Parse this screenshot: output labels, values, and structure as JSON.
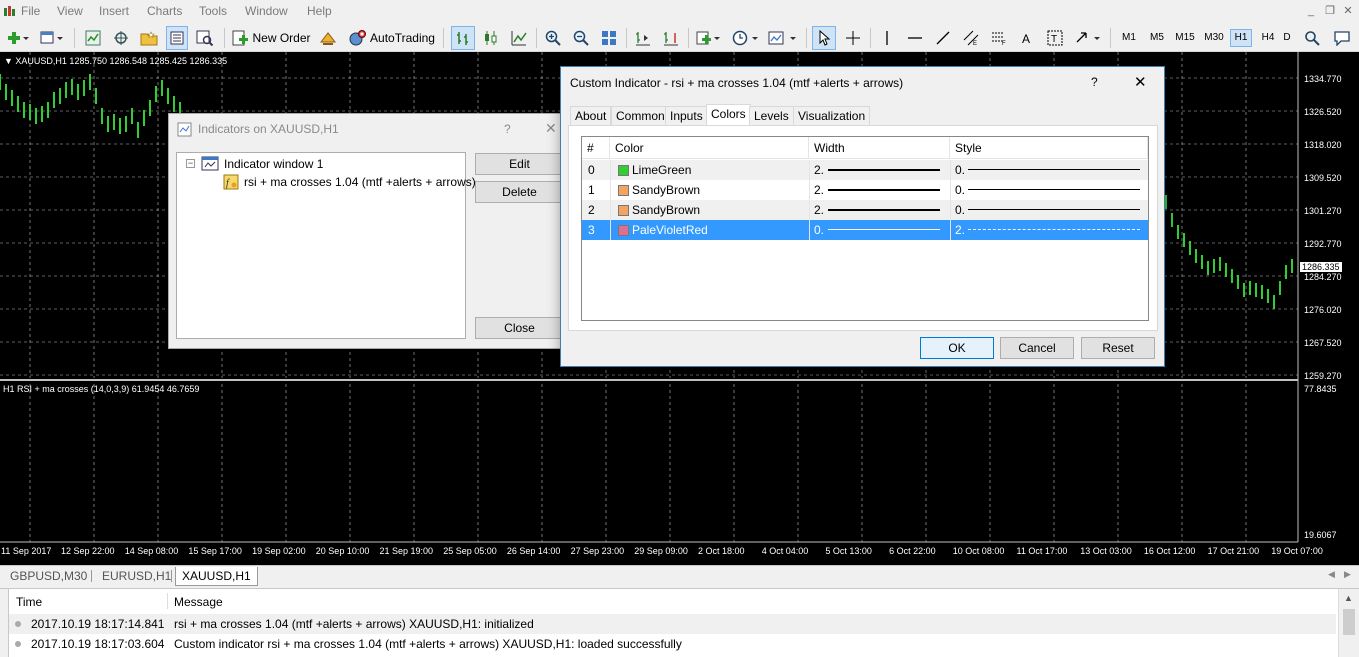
{
  "menu": [
    "File",
    "View",
    "Insert",
    "Charts",
    "Tools",
    "Window",
    "Help"
  ],
  "toolbar": {
    "new_order": "New Order",
    "auto_trading": "AutoTrading",
    "timeframes": [
      "M1",
      "M5",
      "M15",
      "M30",
      "H1",
      "H4",
      "D"
    ],
    "active_timeframe": "H1"
  },
  "chart": {
    "symbol_info": "XAUUSD,H1  1285.750 1286.548 1285.425 1286.335",
    "indicator_info": "H1 RSI + ma crosses (14,0,3,9) 61.9454 46.7659",
    "current_price": "1286.335",
    "price_labels": [
      "1334.770",
      "1326.520",
      "1318.020",
      "1309.520",
      "1301.270",
      "1292.770",
      "1284.270",
      "1276.020",
      "1267.520",
      "1259.270"
    ],
    "indicator_labels": [
      "77.8435",
      "19.6067"
    ],
    "time_labels": [
      "11 Sep 2017",
      "12 Sep 22:00",
      "14 Sep 08:00",
      "15 Sep 17:00",
      "19 Sep 02:00",
      "20 Sep 10:00",
      "21 Sep 19:00",
      "25 Sep 05:00",
      "26 Sep 14:00",
      "27 Sep 23:00",
      "29 Sep 09:00",
      "2 Oct 18:00",
      "4 Oct 04:00",
      "5 Oct 13:00",
      "6 Oct 22:00",
      "10 Oct 08:00",
      "11 Oct 17:00",
      "13 Oct 03:00",
      "16 Oct 12:00",
      "17 Oct 21:00",
      "19 Oct 07:00"
    ],
    "colors": {
      "background": "#000000",
      "candles": "#32cd32",
      "grid": "#bfbfbf",
      "text": "#ffffff"
    }
  },
  "indicators_dialog": {
    "title": "Indicators on XAUUSD,H1",
    "help": "?",
    "close": "✕",
    "tree_root": "Indicator window 1",
    "tree_child": "rsi + ma crosses 1.04 (mtf +alerts + arrows)",
    "edit": "Edit",
    "delete": "Delete",
    "close_btn": "Close"
  },
  "custom_dialog": {
    "title": "Custom Indicator - rsi + ma crosses 1.04 (mtf +alerts + arrows)",
    "help": "?",
    "close": "✕",
    "tabs": [
      "About",
      "Common",
      "Inputs",
      "Colors",
      "Levels",
      "Visualization"
    ],
    "active_tab": "Colors",
    "columns": [
      "#",
      "Color",
      "Width",
      "Style"
    ],
    "rows": [
      {
        "index": "0",
        "color": "LimeGreen",
        "hex": "#32cd32",
        "width": "2.",
        "style": "0."
      },
      {
        "index": "1",
        "color": "SandyBrown",
        "hex": "#f4a460",
        "width": "2.",
        "style": "0."
      },
      {
        "index": "2",
        "color": "SandyBrown",
        "hex": "#f4a460",
        "width": "2.",
        "style": "0."
      },
      {
        "index": "3",
        "color": "PaleVioletRed",
        "hex": "#db7093",
        "width": "0.",
        "style": "2."
      }
    ],
    "ok": "OK",
    "cancel": "Cancel",
    "reset": "Reset"
  },
  "chart_tabs": [
    "GBPUSD,M30",
    "EURUSD,H1",
    "XAUUSD,H1"
  ],
  "active_chart_tab": "XAUUSD,H1",
  "terminal": {
    "columns": [
      "Time",
      "Message"
    ],
    "rows": [
      {
        "time": "2017.10.19 18:17:14.841",
        "message": "rsi + ma crosses 1.04 (mtf +alerts + arrows) XAUUSD,H1: initialized"
      },
      {
        "time": "2017.10.19 18:17:03.604",
        "message": "Custom indicator rsi + ma crosses 1.04 (mtf +alerts + arrows) XAUUSD,H1: loaded successfully"
      }
    ]
  }
}
